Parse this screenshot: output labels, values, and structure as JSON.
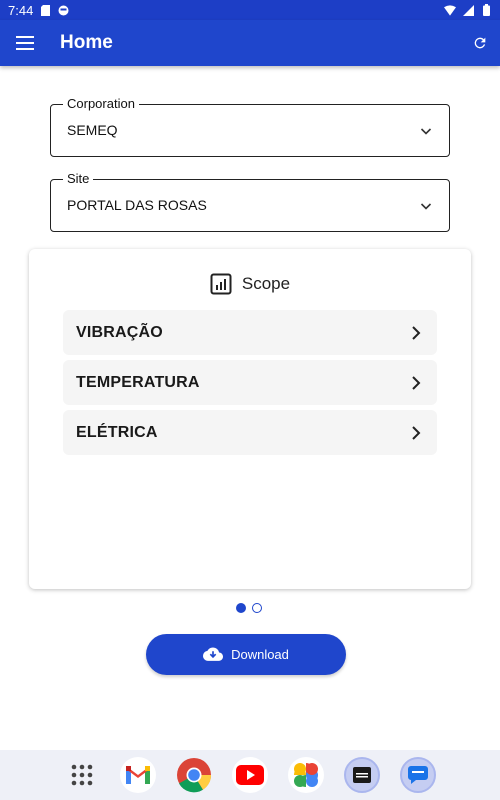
{
  "status_bar": {
    "time": "7:44",
    "icons": [
      "sim-card-icon",
      "app-notification-icon",
      "wifi-icon",
      "signal-icon",
      "battery-icon"
    ]
  },
  "app_bar": {
    "title": "Home",
    "menu_icon": "hamburger-menu-icon",
    "refresh_icon": "refresh-icon"
  },
  "corporation": {
    "label": "Corporation",
    "value": "SEMEQ"
  },
  "site": {
    "label": "Site",
    "value": "PORTAL DAS ROSAS"
  },
  "scope": {
    "title": "Scope",
    "icon": "bar-chart-icon",
    "items": [
      {
        "label": "VIBRAÇÃO"
      },
      {
        "label": "TEMPERATURA"
      },
      {
        "label": "ELÉTRICA"
      }
    ]
  },
  "pager": {
    "count": 2,
    "active_index": 0
  },
  "download": {
    "label": "Download",
    "icon": "cloud-download-icon"
  },
  "dock": {
    "apps": [
      "app-drawer",
      "gmail",
      "chrome",
      "youtube",
      "photos",
      "semeq-app",
      "messages"
    ]
  },
  "colors": {
    "primary": "#1f46cc",
    "status_bar": "#1d3ec6",
    "item_background": "#f5f5f5",
    "dock_background": "#eef0f7"
  }
}
